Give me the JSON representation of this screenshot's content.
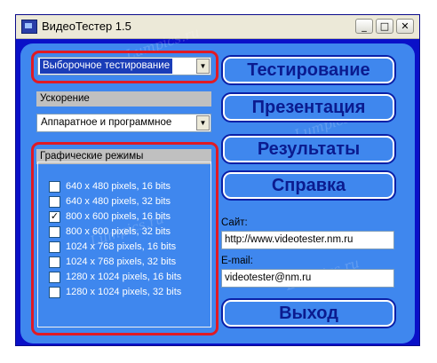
{
  "window": {
    "title": "ВидеоТестер 1.5",
    "buttons": {
      "minimize": "_",
      "maximize": "□",
      "close": "✕"
    }
  },
  "left": {
    "mode_select": {
      "value": "Выборочное тестирование"
    },
    "acceleration": {
      "label": "Ускорение",
      "value": "Аппаратное и программное"
    },
    "graphics_modes": {
      "label": "Графические режимы",
      "items": [
        {
          "label": "640 x 480 pixels, 16 bits",
          "checked": false
        },
        {
          "label": "640 x 480 pixels, 32 bits",
          "checked": false
        },
        {
          "label": "800 x 600 pixels, 16 bits",
          "checked": true
        },
        {
          "label": "800 x 600 pixels, 32 bits",
          "checked": false
        },
        {
          "label": "1024 x 768 pixels, 16 bits",
          "checked": false
        },
        {
          "label": "1024 x 768 pixels, 32 bits",
          "checked": false
        },
        {
          "label": "1280 x 1024 pixels, 16 bits",
          "checked": false
        },
        {
          "label": "1280 x 1024 pixels, 32 bits",
          "checked": false
        }
      ]
    }
  },
  "right": {
    "buttons": {
      "test": "Тестирование",
      "presentation": "Презентация",
      "results": "Результаты",
      "help": "Справка",
      "exit": "Выход"
    },
    "site": {
      "label": "Сайт:",
      "value": "http://www.videotester.nm.ru"
    },
    "email": {
      "label": "E-mail:",
      "value": "videotester@nm.ru"
    }
  },
  "watermark": "Lumpics.ru",
  "colors": {
    "window_blue": "#0a10c8",
    "panel_blue": "#3f87ee",
    "highlight": "#e01a24",
    "button_text": "#0b1b8f"
  }
}
